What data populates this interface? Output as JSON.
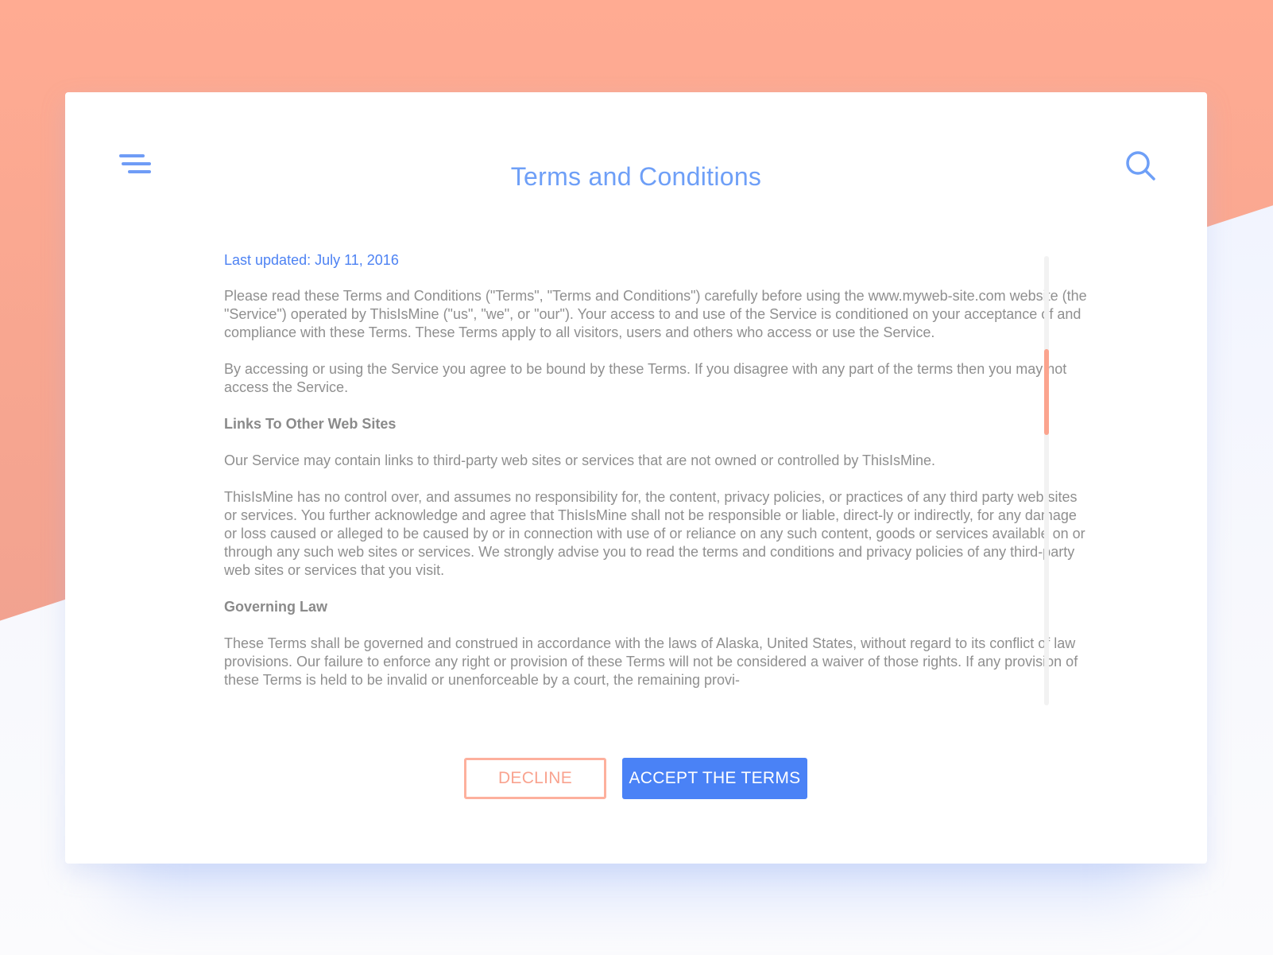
{
  "page": {
    "title": "Terms and Conditions",
    "last_updated": "Last updated: July 11, 2016"
  },
  "header": {
    "menu_icon": "hamburger-menu-icon",
    "search_icon": "search-icon"
  },
  "content": {
    "intro_paragraphs": [
      "Please read these Terms and Conditions (\"Terms\", \"Terms and Conditions\") carefully before using the www.myweb-site.com website (the \"Service\") operated by ThisIsMine (\"us\", \"we\", or \"our\"). Your access to and use of the Service is conditioned on your acceptance of and compliance with these Terms. These Terms apply to all visitors, users and others who access or use the Service.",
      "By accessing or using the Service you agree to be bound by these Terms. If you disagree with any part of the terms then you may not access the Service."
    ],
    "sections": [
      {
        "heading": "Links To Other Web Sites",
        "paragraphs": [
          "Our Service may contain links to third-party web sites or services that are not owned or controlled by ThisIsMine.",
          "ThisIsMine has no control over, and assumes no responsibility for, the content, privacy policies, or practices of any third party web sites or services. You further acknowledge and agree that ThisIsMine shall not be responsible or liable, direct-ly or indirectly, for any damage or loss caused or alleged to be caused by or in connection with use of or reliance on any such content, goods or services available on or through any such web sites or services. We strongly advise you to read the terms and conditions and privacy policies of any third-party web sites or services that you visit."
        ]
      },
      {
        "heading": "Governing Law",
        "paragraphs": [
          "These Terms shall be governed and construed in accordance with the laws of Alaska, United States, without regard to its conflict of law provisions. Our failure to enforce any right or provision of these Terms will not be considered a waiver of those rights. If any provision of these Terms is held to be invalid or unenforceable by a court, the remaining provi-"
        ]
      }
    ]
  },
  "actions": {
    "decline_label": "DECLINE",
    "accept_label": "ACCEPT THE TERMS"
  },
  "scroll": {
    "position_fraction": 0.21
  },
  "colors": {
    "accent_blue": "#4a82f6",
    "title_blue": "#6e9ff7",
    "salmon": "#fba48e",
    "body_text": "#8f8f8f"
  }
}
